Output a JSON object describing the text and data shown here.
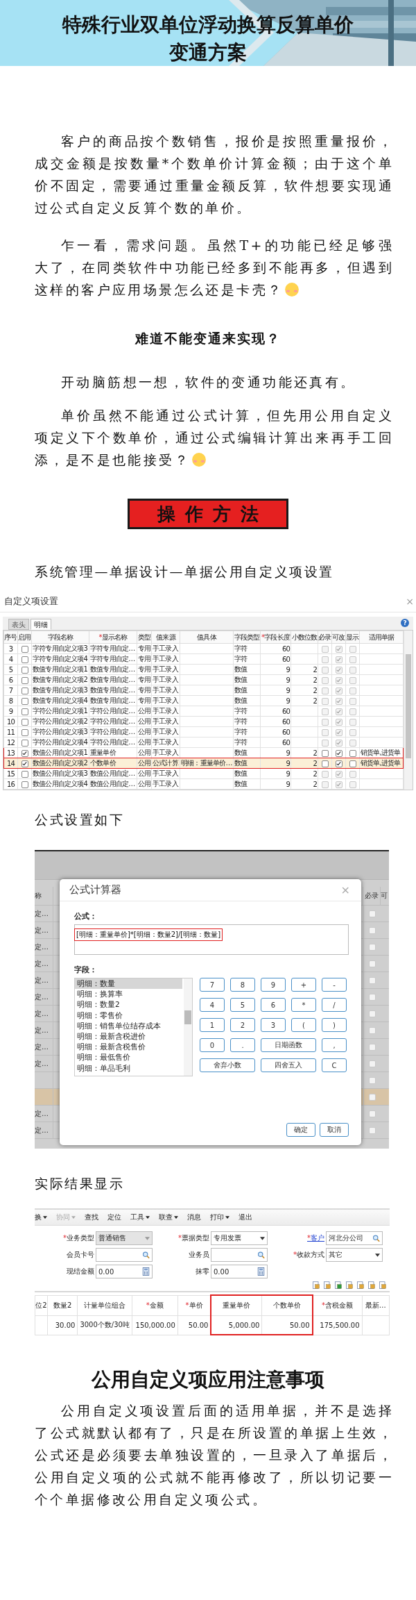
{
  "header": {
    "title_lines": [
      "特殊行业双单位浮动换算反算单价",
      "变通方案"
    ]
  },
  "intro": [
    {
      "text": "客户的商品按个数销售，报价是按照重量报价，成交金额是按数量*个数单价计算金额；由于这个单价不固定，需要通过重量金额反算，软件想要实现通过公式自定义反算个数的单价。",
      "emoji": false
    },
    {
      "text": "乍一看，需求问题。虽然T+的功能已经足够强大了，在同类软件中功能已经多到不能再多，但遇到这样的客户应用场景怎么还是卡壳？",
      "emoji": true
    }
  ],
  "question": "难道不能变通来实现？",
  "answer": [
    {
      "text": "开动脑筋想一想，软件的变通功能还真有。",
      "emoji": false
    },
    {
      "text": "单价虽然不能通过公式计算，但先用公用自定义项定义下个数单价，通过公式编辑计算出来再手工回添，是不是也能接受？",
      "emoji": true
    }
  ],
  "method_banner": "操作方法",
  "path_caption": "系统管理—单据设计—单据公用自定义项设置",
  "settings_dialog": {
    "title": "自定义项设置",
    "close": "×",
    "help": "?",
    "tabs": [
      {
        "label": "表头",
        "selected": false
      },
      {
        "label": "明细",
        "selected": true
      }
    ],
    "columns": [
      {
        "label": "序号"
      },
      {
        "label": "启用"
      },
      {
        "label": "字段名称"
      },
      {
        "label": "显示名称",
        "mark": "*"
      },
      {
        "label": "类型"
      },
      {
        "label": "值来源"
      },
      {
        "label": "值具体"
      },
      {
        "label": "字段类型"
      },
      {
        "label": "字段长度",
        "mark": "*"
      },
      {
        "label": "小数位数"
      },
      {
        "label": "必录"
      },
      {
        "label": "可改"
      },
      {
        "label": "显示"
      },
      {
        "label": "适用单据"
      }
    ],
    "rows": [
      {
        "no": "3",
        "enabled": false,
        "field": "字符专用自定义项3",
        "display": "字符专用自定…",
        "type": "专用",
        "source": "手工录入",
        "field_type": "字符",
        "length": "60",
        "required": false,
        "editable": true,
        "shown": false,
        "locked": true,
        "selected": false,
        "marked": false
      },
      {
        "no": "4",
        "enabled": false,
        "field": "字符专用自定义项4",
        "display": "字符专用自定…",
        "type": "专用",
        "source": "手工录入",
        "field_type": "字符",
        "length": "60",
        "required": false,
        "editable": true,
        "shown": false,
        "locked": true,
        "selected": false,
        "marked": false
      },
      {
        "no": "5",
        "enabled": false,
        "field": "数值专用自定义项1",
        "display": "数值专用自定…",
        "type": "专用",
        "source": "手工录入",
        "field_type": "数值",
        "length": "9",
        "decimals": "2",
        "required": false,
        "editable": true,
        "shown": false,
        "locked": true,
        "selected": false,
        "marked": false
      },
      {
        "no": "6",
        "enabled": false,
        "field": "数值专用自定义项2",
        "display": "数值专用自定…",
        "type": "专用",
        "source": "手工录入",
        "field_type": "数值",
        "length": "9",
        "decimals": "2",
        "required": false,
        "editable": true,
        "shown": false,
        "locked": true,
        "selected": false,
        "marked": false
      },
      {
        "no": "7",
        "enabled": false,
        "field": "数值专用自定义项3",
        "display": "数值专用自定…",
        "type": "专用",
        "source": "手工录入",
        "field_type": "数值",
        "length": "9",
        "decimals": "2",
        "required": false,
        "editable": true,
        "shown": false,
        "locked": true,
        "selected": false,
        "marked": false
      },
      {
        "no": "8",
        "enabled": false,
        "field": "数值专用自定义项4",
        "display": "数值专用自定…",
        "type": "专用",
        "source": "手工录入",
        "field_type": "数值",
        "length": "9",
        "decimals": "2",
        "required": false,
        "editable": true,
        "shown": false,
        "locked": true,
        "selected": false,
        "marked": false
      },
      {
        "no": "9",
        "enabled": false,
        "field": "字符公用自定义项1",
        "display": "字符公用自定…",
        "type": "公用",
        "source": "手工录入",
        "field_type": "字符",
        "length": "60",
        "required": false,
        "editable": true,
        "shown": false,
        "locked": true,
        "selected": false,
        "marked": false
      },
      {
        "no": "10",
        "enabled": false,
        "field": "字符公用自定义项2",
        "display": "字符公用自定…",
        "type": "公用",
        "source": "手工录入",
        "field_type": "字符",
        "length": "60",
        "required": false,
        "editable": true,
        "shown": false,
        "locked": true,
        "selected": false,
        "marked": false
      },
      {
        "no": "11",
        "enabled": false,
        "field": "字符公用自定义项3",
        "display": "字符公用自定…",
        "type": "公用",
        "source": "手工录入",
        "field_type": "字符",
        "length": "60",
        "required": false,
        "editable": true,
        "shown": false,
        "locked": true,
        "selected": false,
        "marked": false
      },
      {
        "no": "12",
        "enabled": false,
        "field": "字符公用自定义项4",
        "display": "字符公用自定…",
        "type": "公用",
        "source": "手工录入",
        "field_type": "字符",
        "length": "60",
        "required": false,
        "editable": true,
        "shown": false,
        "locked": true,
        "selected": false,
        "marked": false
      },
      {
        "no": "13",
        "enabled": true,
        "field": "数值公用自定义项1",
        "display": "重量单价",
        "type": "公用",
        "source": "手工录入",
        "field_type": "数值",
        "length": "9",
        "decimals": "2",
        "required": false,
        "editable": true,
        "shown": false,
        "locked": false,
        "documents": "销货单,进货单",
        "selected": false,
        "marked": true
      },
      {
        "no": "14",
        "enabled": true,
        "field": "数值公用自定义项2",
        "display": "个数单价",
        "type": "公用",
        "source": "公式计算",
        "detail": "明细：重量单价…",
        "field_type": "数值",
        "length": "9",
        "decimals": "2",
        "required": false,
        "editable": true,
        "shown": false,
        "locked": false,
        "documents": "销货单,进货单",
        "selected": true,
        "marked": true
      },
      {
        "no": "15",
        "enabled": false,
        "field": "数值公用自定义项3",
        "display": "数值公用自定…",
        "type": "公用",
        "source": "手工录入",
        "field_type": "数值",
        "length": "9",
        "decimals": "2",
        "required": false,
        "editable": true,
        "shown": false,
        "locked": true,
        "selected": false,
        "marked": false
      },
      {
        "no": "16",
        "enabled": false,
        "field": "数值公用自定义项4",
        "display": "数值公用自定…",
        "type": "公用",
        "source": "手工录入",
        "field_type": "数值",
        "length": "9",
        "decimals": "2",
        "required": false,
        "editable": true,
        "shown": false,
        "locked": true,
        "selected": false,
        "marked": false
      }
    ]
  },
  "formula_caption": "公式设置如下",
  "formula_screen": {
    "background_columns": [
      "称",
      "必录",
      "可"
    ],
    "background_rows": [
      {
        "text": "定…",
        "selected": false
      },
      {
        "text": "定…",
        "selected": false
      },
      {
        "text": "定…",
        "selected": false
      },
      {
        "text": "定…",
        "selected": false
      },
      {
        "text": "定…",
        "selected": false
      },
      {
        "text": "定…",
        "selected": false
      },
      {
        "text": "定…",
        "selected": false
      },
      {
        "text": "定…",
        "selected": false
      },
      {
        "text": "定…",
        "selected": false
      },
      {
        "text": "定…",
        "selected": false
      },
      {
        "selected": false
      },
      {
        "selected": true
      },
      {
        "text": "定…",
        "selected": false
      },
      {
        "text": "定…",
        "selected": false
      }
    ],
    "dialog": {
      "title": "公式计算器",
      "close": "×",
      "formula_label": "公式：",
      "formula": "[明细：重量单价]*[明细：数量2]/[明细：数量]",
      "formula_highlighted": true,
      "fields_label": "字段：",
      "fields": [
        {
          "label": "明细：数量",
          "selected": true
        },
        {
          "label": "明细：换算率",
          "selected": false
        },
        {
          "label": "明细：数量2",
          "selected": false
        },
        {
          "label": "明细：零售价",
          "selected": false
        },
        {
          "label": "明细：销售单位结存成本",
          "selected": false
        },
        {
          "label": "明细：最新含税进价",
          "selected": false
        },
        {
          "label": "明细：最新含税售价",
          "selected": false
        },
        {
          "label": "明细：最低售价",
          "selected": false
        },
        {
          "label": "明细：单品毛利",
          "selected": false
        }
      ],
      "keys": [
        {
          "label": "7",
          "kind": "normal"
        },
        {
          "label": "8",
          "kind": "normal"
        },
        {
          "label": "9",
          "kind": "normal"
        },
        {
          "label": "+",
          "kind": "normal"
        },
        {
          "label": "-",
          "kind": "normal"
        },
        {
          "label": "4",
          "kind": "normal"
        },
        {
          "label": "5",
          "kind": "normal"
        },
        {
          "label": "6",
          "kind": "normal"
        },
        {
          "label": "*",
          "kind": "normal"
        },
        {
          "label": "/",
          "kind": "normal"
        },
        {
          "label": "1",
          "kind": "normal"
        },
        {
          "label": "2",
          "kind": "normal"
        },
        {
          "label": "3",
          "kind": "normal"
        },
        {
          "label": "(",
          "kind": "normal"
        },
        {
          "label": ")",
          "kind": "normal"
        },
        {
          "label": "0",
          "kind": "normal"
        },
        {
          "label": ".",
          "kind": "normal"
        },
        {
          "label": "日期函数",
          "kind": "wide"
        },
        {
          "label": ",",
          "kind": "normal"
        },
        {
          "label": "舍弃小数",
          "kind": "wide"
        },
        {
          "label": "四舍五入",
          "kind": "wide"
        },
        {
          "label": "C",
          "kind": "normal"
        }
      ],
      "buttons": [
        "确定",
        "取消"
      ]
    }
  },
  "result_caption": "实际结果显示",
  "sales_screen": {
    "toolbar": [
      {
        "label": "换",
        "menu": true,
        "disabled": false
      },
      {
        "label": "协同",
        "menu": true,
        "disabled": true
      },
      {
        "label": "查找",
        "menu": false,
        "disabled": false
      },
      {
        "label": "定位",
        "menu": false,
        "disabled": false
      },
      {
        "label": "工具",
        "menu": true,
        "disabled": false
      },
      {
        "label": "联查",
        "menu": true,
        "disabled": false
      },
      {
        "label": "消息",
        "menu": false,
        "disabled": false
      },
      {
        "label": "打印",
        "menu": true,
        "disabled": false
      },
      {
        "label": "退出",
        "menu": false,
        "disabled": false
      }
    ],
    "form_rows": [
      [
        {
          "label": "业务类型",
          "mark": "*",
          "value": "普通销售",
          "kind": "select",
          "disabled": true,
          "link": false
        },
        {
          "label": "票据类型",
          "mark": "*",
          "value": "专用发票",
          "kind": "select",
          "disabled": false,
          "link": false
        },
        {
          "label": "客户",
          "mark": "*",
          "value": "河北分公司",
          "kind": "search",
          "disabled": false,
          "link": true
        }
      ],
      [
        {
          "label": "会员卡号",
          "kind": "search",
          "disabled": false,
          "link": false
        },
        {
          "label": "业务员",
          "kind": "search",
          "disabled": false,
          "link": false
        },
        {
          "label": "收款方式",
          "mark": "*",
          "value": "其它",
          "kind": "select",
          "disabled": false,
          "link": false
        }
      ],
      [
        {
          "label": "现结金额",
          "value": "0.00",
          "kind": "calc",
          "disabled": false,
          "link": false
        },
        {
          "label": "抹零",
          "value": "0.00",
          "kind": "calc",
          "disabled": false,
          "link": false
        }
      ]
    ],
    "columns": [
      {
        "label": "位2",
        "marked": false
      },
      {
        "label": "数量2",
        "value": "30.00",
        "marked": false
      },
      {
        "label": "计量单位组合",
        "value": "3000个数/30吨",
        "marked": false
      },
      {
        "label": "金额",
        "mark": "*",
        "value": "150,000.00",
        "marked": false
      },
      {
        "label": "单价",
        "mark": "*",
        "value": "50.00",
        "marked": false
      },
      {
        "label": "重量单价",
        "value": "5,000.00",
        "marked": true
      },
      {
        "label": "个数单价",
        "value": "50.00",
        "marked": true
      },
      {
        "label": "含税金额",
        "mark": "*",
        "value": "175,500.00",
        "marked": false
      },
      {
        "label": "最新…",
        "marked": false
      }
    ]
  },
  "notes_heading": "公用自定义项应用注意事项",
  "notes": "公用自定义项设置后面的适用单据，并不是选择了公式就默认都有了，只是在所设置的单据上生效，公式还是必须要去单独设置的，一旦录入了单据后，公用自定义项的公式就不能再修改了，所以切记要一个个单据修改公用自定义项公式。"
}
